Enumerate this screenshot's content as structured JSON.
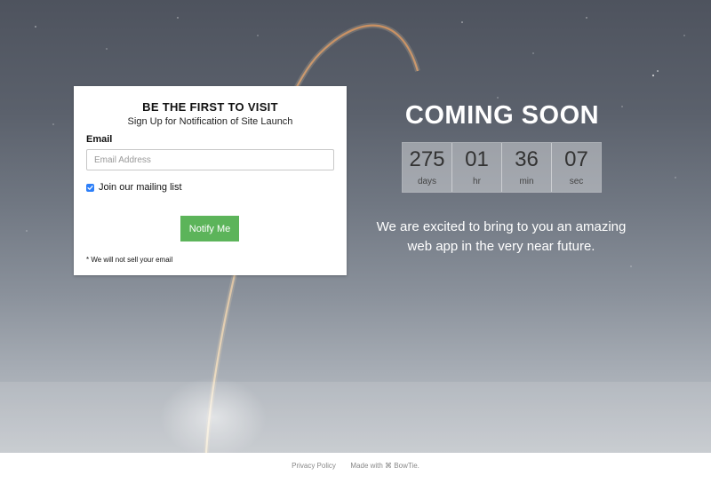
{
  "signup": {
    "title": "BE THE FIRST TO VISIT",
    "subtitle": "Sign Up for Notification of Site Launch",
    "email_label": "Email",
    "email_placeholder": "Email Address",
    "email_value": "",
    "mailing_checked": true,
    "mailing_label": "Join our mailing list",
    "button_label": "Notify Me",
    "disclaimer": "* We will not sell your email"
  },
  "launch": {
    "heading": "COMING SOON",
    "countdown": [
      {
        "value": "275",
        "unit": "days"
      },
      {
        "value": "01",
        "unit": "hr"
      },
      {
        "value": "36",
        "unit": "min"
      },
      {
        "value": "07",
        "unit": "sec"
      }
    ],
    "tagline": "We are excited to bring to you an amazing web app in the very near future."
  },
  "footer": {
    "privacy_label": "Privacy Policy",
    "made_with_label": "Made with ⌘ BowTie."
  },
  "colors": {
    "button": "#5cb45a",
    "checkbox": "#2d7ff9",
    "card_bg": "#ffffff",
    "hero_top": "#4e535e",
    "hero_bottom": "#c2c6cb"
  }
}
